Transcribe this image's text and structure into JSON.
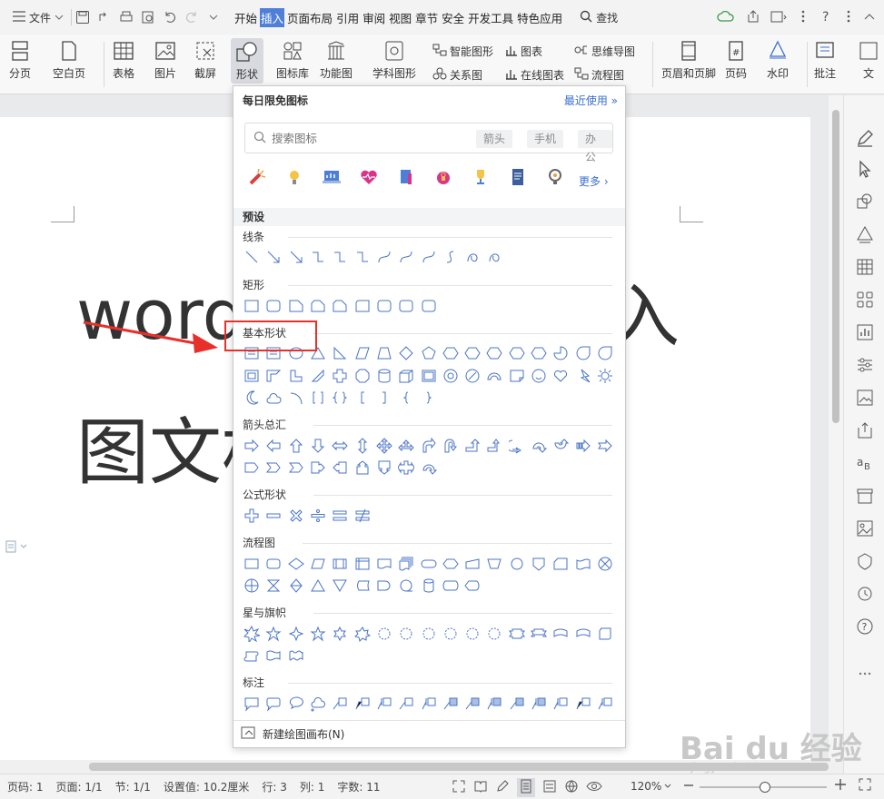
{
  "menubar": {
    "file_label": "文件",
    "tabs": [
      "开始",
      "插入",
      "页面布局",
      "引用",
      "审阅",
      "视图",
      "章节",
      "安全",
      "开发工具",
      "特色应用"
    ],
    "active_tab": "插入",
    "search_label": "查找"
  },
  "ribbon": {
    "page_break": "分页",
    "blank_page": "空白页",
    "table": "表格",
    "picture": "图片",
    "screenshot": "截屏",
    "shapes": "形状",
    "icon_lib": "图标库",
    "func_chart": "功能图",
    "science": "学科图形",
    "smart_shape": "智能图形",
    "chart": "图表",
    "mindmap": "思维导图",
    "relation": "关系图",
    "online_chart": "在线图表",
    "flowchart": "流程图",
    "header_footer": "页眉和页脚",
    "page_num": "页码",
    "watermark": "水印",
    "comment": "批注",
    "text_cut": "文"
  },
  "document": {
    "line1_left": "word",
    "line1_right": "入",
    "line2": "图文框"
  },
  "dropdown": {
    "header": "每日限免图标",
    "recent": "最近使用",
    "search_placeholder": "搜索图标",
    "tags": [
      "箭头",
      "手机",
      "办公"
    ],
    "more": "更多",
    "preset": "预设",
    "sections": {
      "lines": "线条",
      "rect": "矩形",
      "basic": "基本形状",
      "arrows": "箭头总汇",
      "formula": "公式形状",
      "flow": "流程图",
      "stars": "星与旗帜",
      "callout": "标注"
    },
    "footer": "新建绘图画布(N)"
  },
  "statusbar": {
    "page_num": "页码: 1",
    "pages": "页面: 1/1",
    "section": "节: 1/1",
    "setting": "设置值: 10.2厘米",
    "row": "行: 3",
    "col": "列: 1",
    "wordcount": "字数: 11",
    "zoom": "120%"
  },
  "watermark": {
    "main": "Bai du 经验",
    "sub": "jingyan.baidu.com"
  },
  "colors": {
    "accent": "#4f7fd8",
    "highlight_box": "#e8302a",
    "shape_stroke": "#4a74c4"
  }
}
